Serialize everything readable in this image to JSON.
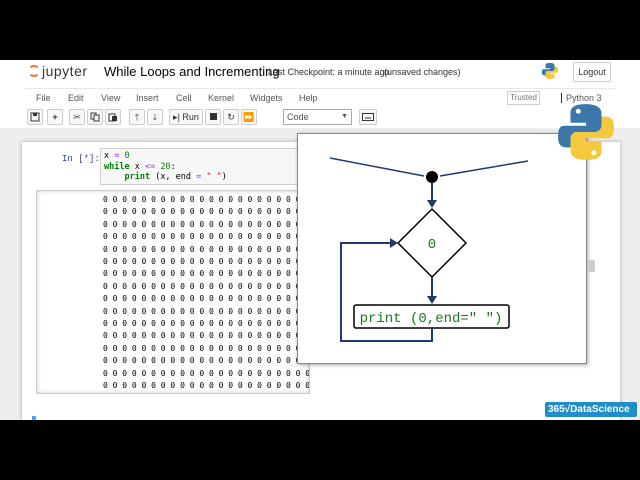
{
  "header": {
    "logo_text": "jupyter",
    "notebook_title": "While Loops and Incrementing",
    "checkpoint": "Last Checkpoint: a minute ago",
    "unsaved": "(unsaved changes)",
    "logout_label": "Logout"
  },
  "menubar": {
    "items": [
      "File",
      "Edit",
      "View",
      "Insert",
      "Cell",
      "Kernel",
      "Widgets",
      "Help"
    ],
    "trusted": "Trusted",
    "kernel_name": "Python 3"
  },
  "toolbar": {
    "run_label": "Run",
    "cell_type": "Code"
  },
  "cell": {
    "prompt": "In [*]:",
    "code_lines": [
      {
        "parts": [
          [
            "",
            "x "
          ],
          [
            "op",
            "="
          ],
          [
            "num",
            " 0"
          ]
        ]
      },
      {
        "parts": [
          [
            "kw",
            "while"
          ],
          [
            "",
            " x "
          ],
          [
            "op",
            "<="
          ],
          [
            "num",
            " 20"
          ],
          [
            "",
            ":"
          ]
        ]
      },
      {
        "parts": [
          [
            "",
            "    "
          ],
          [
            "kw",
            "print"
          ],
          [
            "",
            " (x, end "
          ],
          [
            "op",
            "="
          ],
          [
            "str",
            " \" \""
          ],
          [
            "",
            ")"
          ]
        ]
      }
    ],
    "output_char": "0",
    "output_rows": 16
  },
  "diagram": {
    "condition_value": "0",
    "print_statement": "print (0,end=\" \")"
  },
  "brand": "365√DataScience"
}
